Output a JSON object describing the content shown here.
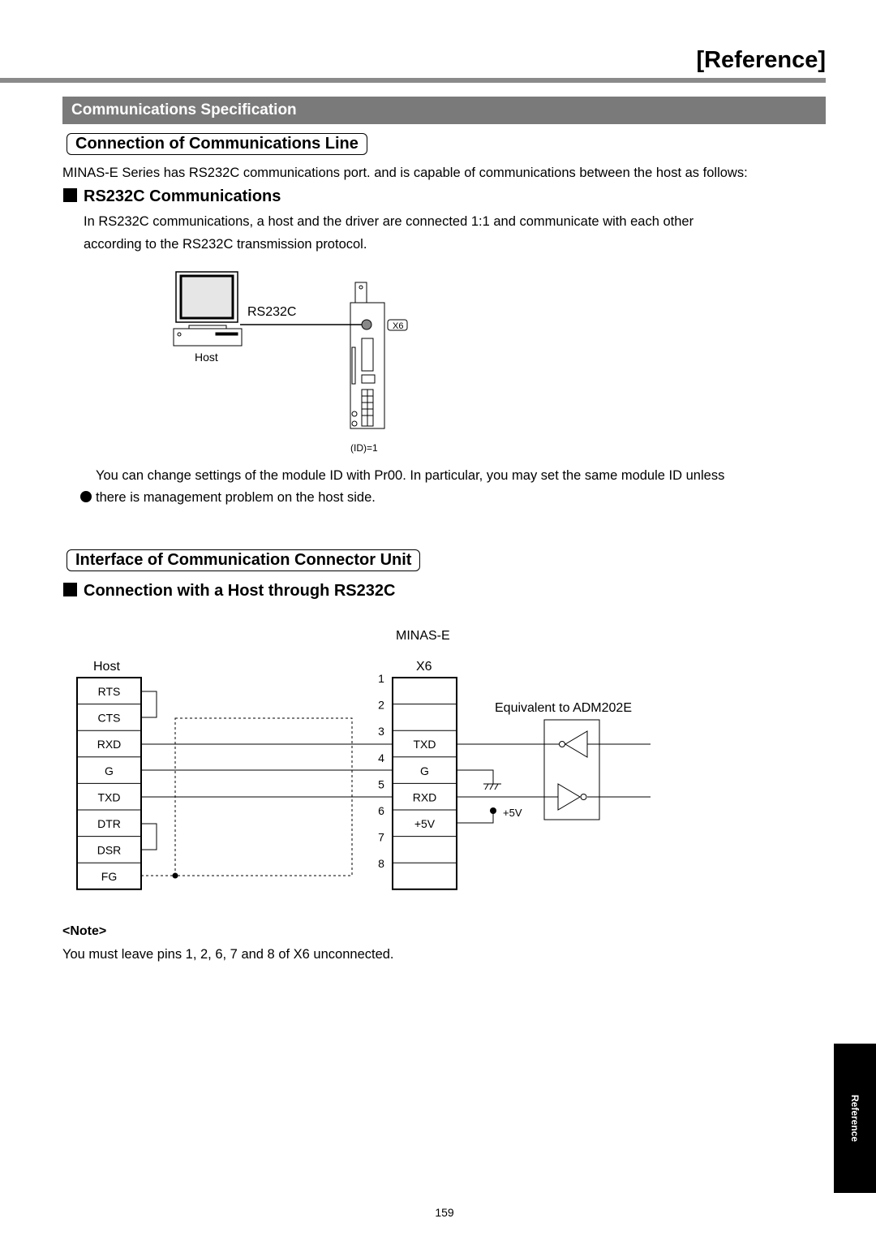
{
  "header": {
    "title": "[Reference]"
  },
  "section": {
    "title": "Communications Specification"
  },
  "part1": {
    "heading": "Connection of Communications Line",
    "intro": "MINAS-E Series has RS232C communications port. and is capable of communications between the host as follows:",
    "subheading": "RS232C Communications",
    "body_line1": "In RS232C communications, a host and the driver are connected 1:1 and communicate with each other",
    "body_line2": "according to the RS232C transmission protocol.",
    "figure": {
      "cable_label": "RS232C",
      "host_label": "Host",
      "connector_label": "X6",
      "id_label": "(ID)=1"
    },
    "note_line1": "You can change settings of the module ID with Pr00.  In particular, you may set the same module ID unless",
    "note_line2": "there is management problem on the host side."
  },
  "part2": {
    "heading": "Interface of Communication Connector Unit",
    "subheading": "Connection with a Host through RS232C",
    "diagram": {
      "driver_label": "MINAS-E",
      "host_label": "Host",
      "connector_label": "X6",
      "host_pins": [
        "RTS",
        "CTS",
        "RXD",
        "G",
        "TXD",
        "DTR",
        "DSR",
        "FG"
      ],
      "pin_numbers": [
        "1",
        "2",
        "3",
        "4",
        "5",
        "6",
        "7",
        "8"
      ],
      "x6_pins": [
        "",
        "",
        "TXD",
        "G",
        "RXD",
        "+5V",
        "",
        ""
      ],
      "chip_label": "Equivalent to ADM202E",
      "supply_label": "+5V"
    },
    "note_title": "<Note>",
    "note_text": "You must leave pins 1, 2, 6, 7 and 8 of X6 unconnected."
  },
  "side_tab": {
    "label": "Reference"
  },
  "footer": {
    "page_number": "159"
  }
}
